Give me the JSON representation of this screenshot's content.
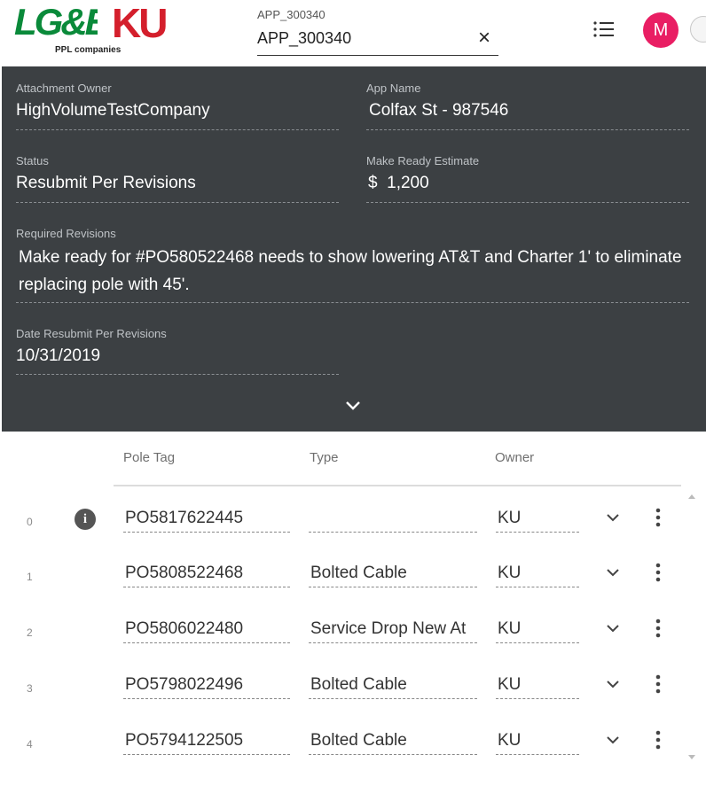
{
  "header": {
    "logo_lge": "LG&E",
    "logo_ku": "KU",
    "logo_sub": "PPL companies",
    "search_label": "APP_300340",
    "search_value": "APP_300340",
    "clear_icon": "close-icon",
    "menu_icon": "list-icon",
    "avatar_letter": "M",
    "avatar_color": "#e91e63"
  },
  "details": {
    "attachment_owner_label": "Attachment Owner",
    "attachment_owner": "HighVolumeTestCompany",
    "app_name_label": "App Name",
    "app_name": "Colfax St - 987546",
    "status_label": "Status",
    "status": "Resubmit Per Revisions",
    "make_ready_label": "Make Ready Estimate",
    "make_ready": "$  1,200",
    "required_revisions_label": "Required Revisions",
    "required_revisions": "Make ready for #PO580522468 needs to show lowering AT&T and Charter 1' to eliminate replacing pole with 45'.",
    "date_label": "Date Resubmit Per Revisions",
    "date": "10/31/2019",
    "panel_color": "#3c4043"
  },
  "table": {
    "columns": {
      "pole_tag": "Pole Tag",
      "type": "Type",
      "owner": "Owner"
    },
    "rows": [
      {
        "index": "0",
        "pole_tag": "PO5817622445",
        "type": "",
        "owner": "KU"
      },
      {
        "index": "1",
        "pole_tag": "PO5808522468",
        "type": "Bolted Cable",
        "owner": "KU"
      },
      {
        "index": "2",
        "pole_tag": "PO5806022480",
        "type": "Service Drop New At",
        "owner": "KU"
      },
      {
        "index": "3",
        "pole_tag": "PO5798022496",
        "type": "Bolted Cable",
        "owner": "KU"
      },
      {
        "index": "4",
        "pole_tag": "PO5794122505",
        "type": "Bolted Cable",
        "owner": "KU"
      }
    ]
  }
}
